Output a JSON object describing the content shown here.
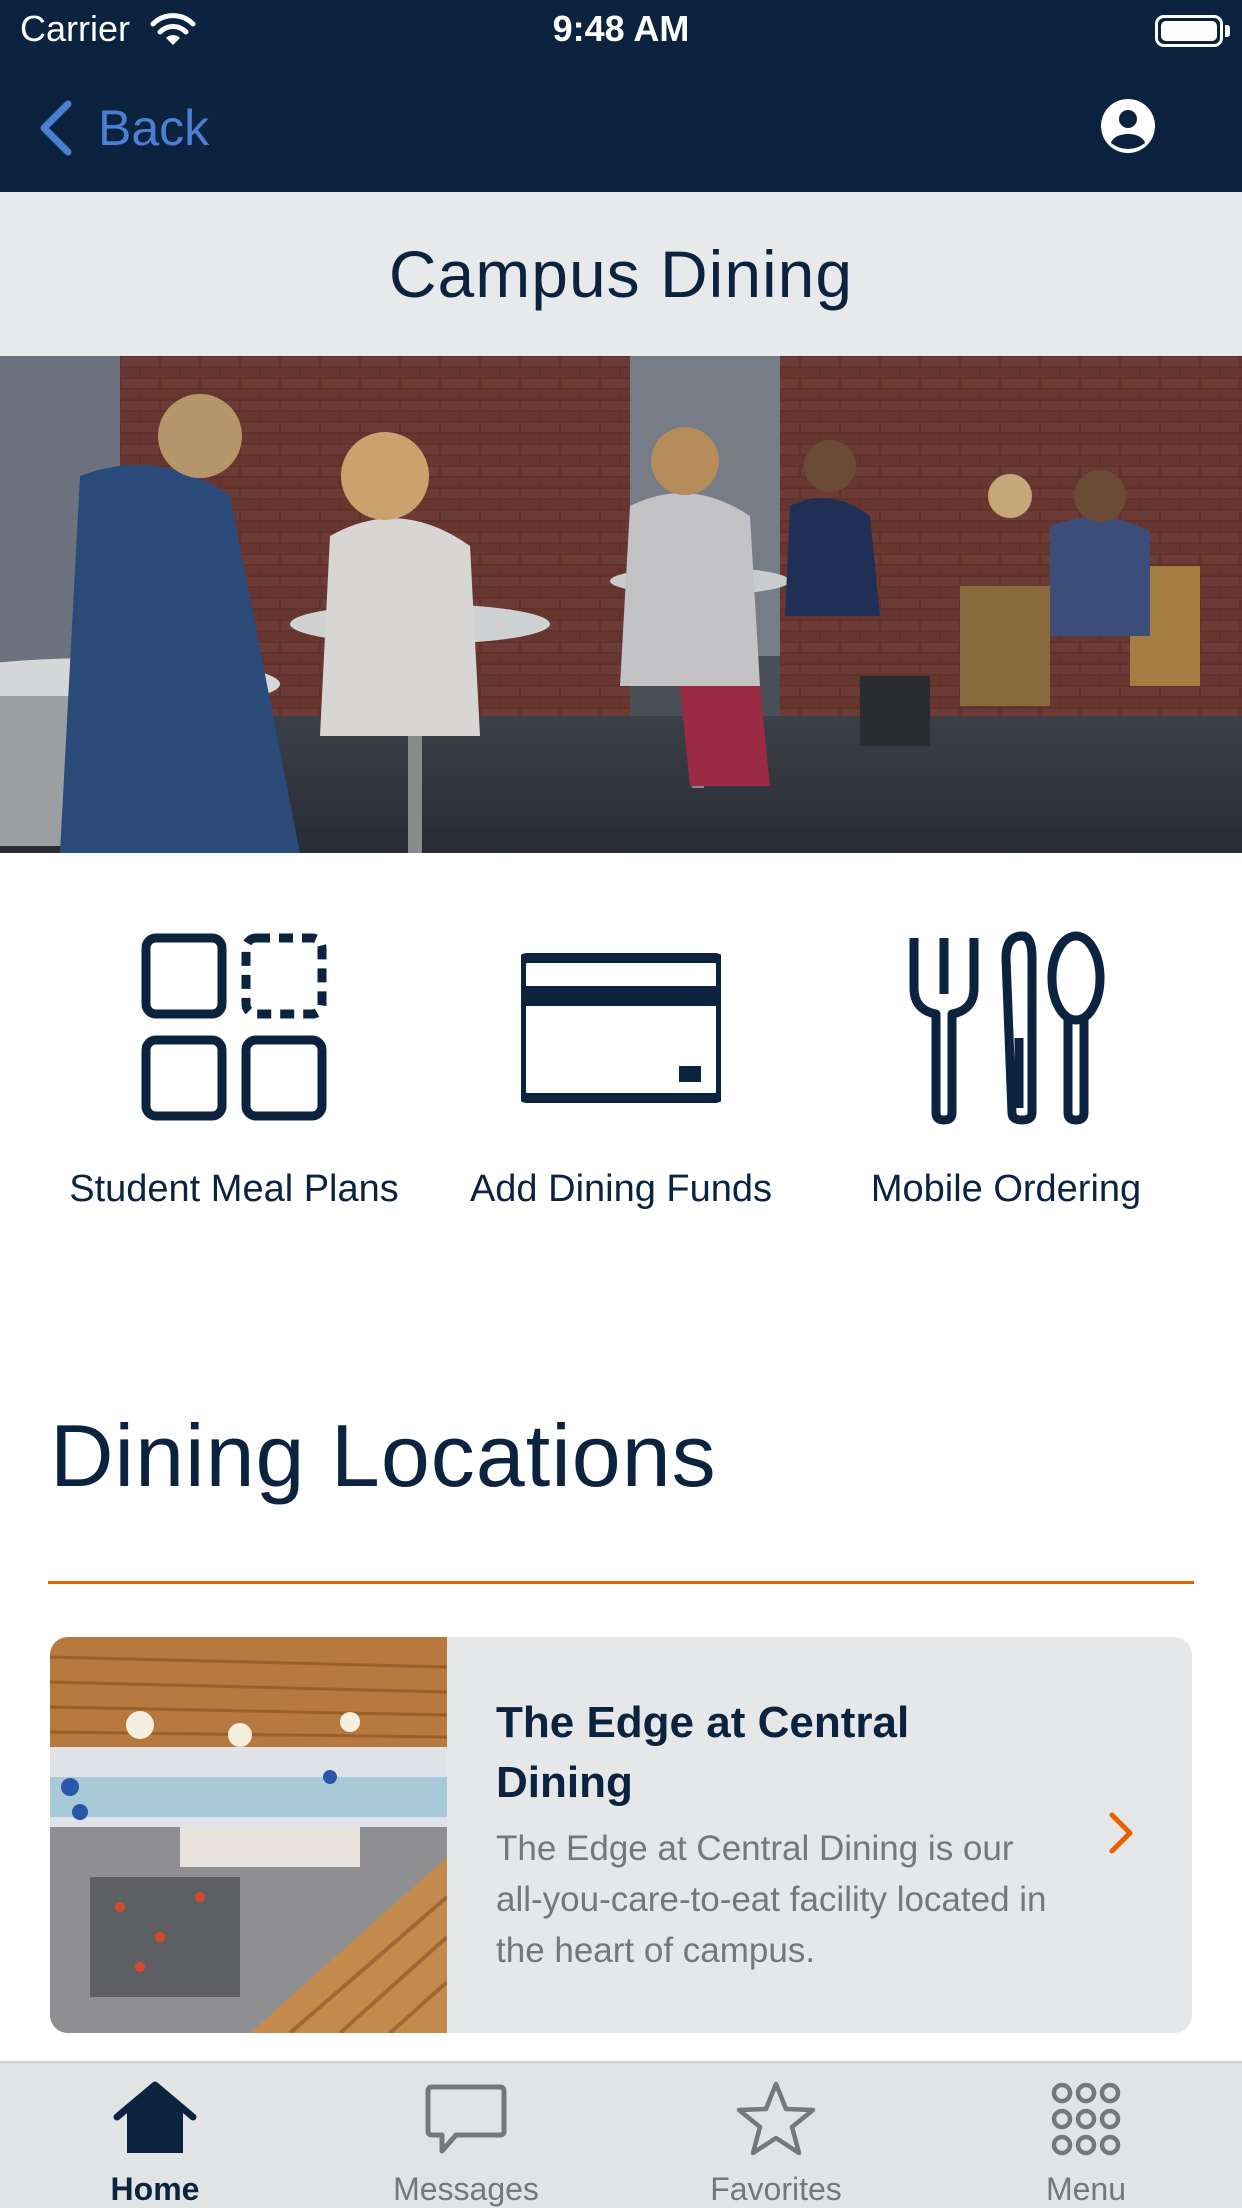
{
  "status_bar": {
    "carrier": "Carrier",
    "time": "9:48 AM"
  },
  "nav": {
    "back_label": "Back",
    "icons": [
      "chevron-left-icon",
      "user-profile-icon"
    ]
  },
  "page": {
    "title": "Campus Dining"
  },
  "quick_actions": [
    {
      "label": "Student Meal Plans",
      "icon": "meal-plans-grid-icon"
    },
    {
      "label": "Add Dining Funds",
      "icon": "credit-card-icon"
    },
    {
      "label": "Mobile Ordering",
      "icon": "utensils-icon"
    }
  ],
  "locations": {
    "heading": "Dining Locations",
    "items": [
      {
        "title": "The Edge at Central Dining",
        "description": "The Edge at Central Dining is our all-you-care-to-eat facility located in the heart of campus.",
        "icon": "chevron-right-icon"
      }
    ]
  },
  "tab_bar": {
    "tabs": [
      {
        "label": "Home",
        "icon": "home-icon",
        "active": true
      },
      {
        "label": "Messages",
        "icon": "message-icon",
        "active": false
      },
      {
        "label": "Favorites",
        "icon": "star-icon",
        "active": false
      },
      {
        "label": "Menu",
        "icon": "grid-dots-icon",
        "active": false
      }
    ]
  },
  "colors": {
    "navy": "#0c2340",
    "orange": "#e86100",
    "link_blue": "#4a7fd1",
    "gray_text": "#75787b",
    "band_gray": "#e8e9eb"
  }
}
